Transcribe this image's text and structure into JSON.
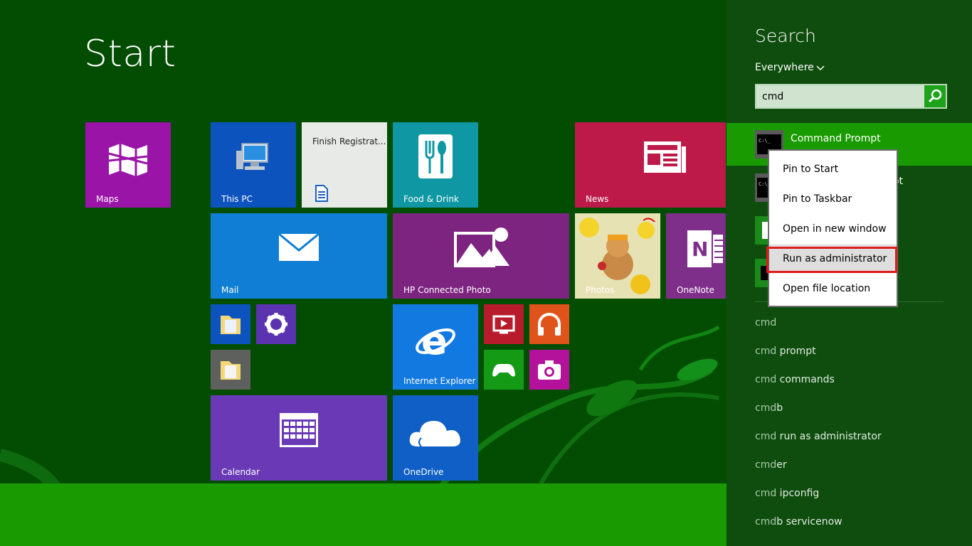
{
  "start": {
    "title": "Start"
  },
  "tiles": {
    "maps": "Maps",
    "this_pc": "This PC",
    "finish_registration": "Finish Registrat...",
    "food_drink": "Food & Drink",
    "news": "News",
    "mail": "Mail",
    "hp_connected_photo": "HP Connected Photo",
    "photos": "Photos",
    "onenote": "OneNote",
    "internet_explorer": "Internet Explorer",
    "calendar": "Calendar",
    "onedrive": "OneDrive"
  },
  "search": {
    "title": "Search",
    "scope": "Everywhere",
    "query": "cmd",
    "results": [
      {
        "label": "Command Prompt",
        "icon": "cmd-icon"
      },
      {
        "label": "mpt",
        "icon": "cmd-icon"
      }
    ],
    "suggestions": [
      {
        "match": "cmd",
        "rest": ""
      },
      {
        "match": "cmd",
        "rest": " prompt"
      },
      {
        "match": "cmd",
        "rest": " commands"
      },
      {
        "match": "cmd",
        "rest": "b"
      },
      {
        "match": "cmd",
        "rest": " run as administrator"
      },
      {
        "match": "cmd",
        "rest": "er"
      },
      {
        "match": "cmd",
        "rest": " ipconfig"
      },
      {
        "match": "cmd",
        "rest": "b servicenow"
      }
    ]
  },
  "context_menu": {
    "items": [
      "Pin to Start",
      "Pin to Taskbar",
      "Open in new window",
      "Run as administrator",
      "Open file location"
    ]
  },
  "colors": {
    "background": "#024d02",
    "accent": "#199b00",
    "highlight_box": "#e21a1a"
  }
}
